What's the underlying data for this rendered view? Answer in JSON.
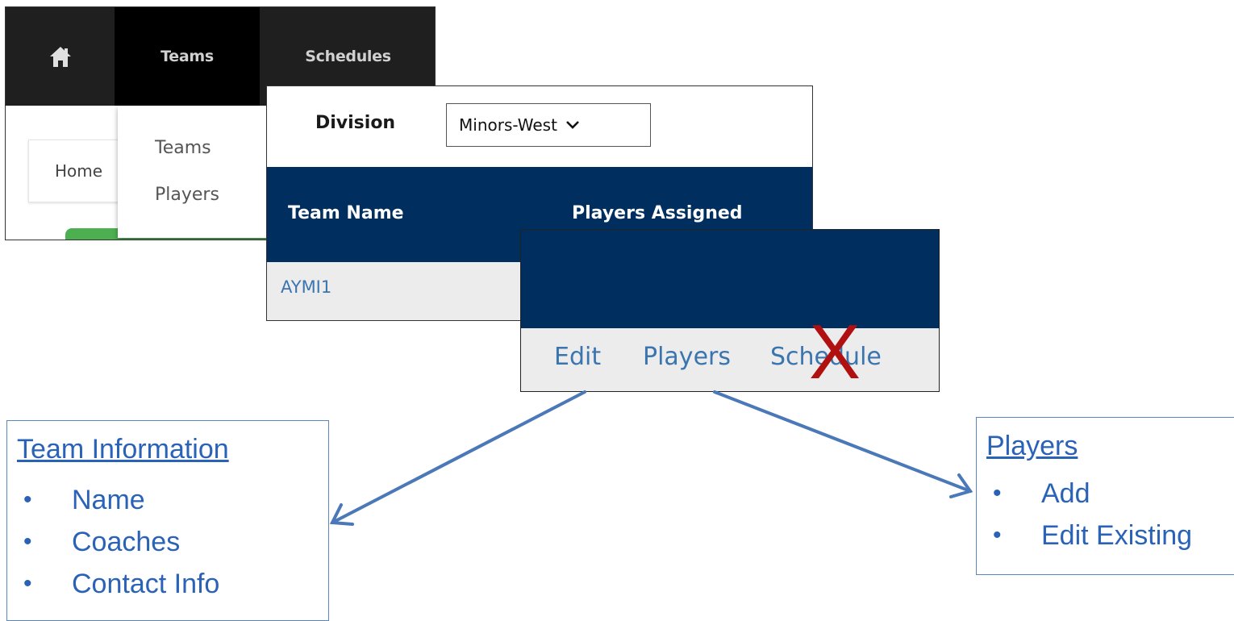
{
  "nav": {
    "home_icon": "home-icon",
    "items": [
      {
        "label": "Teams"
      },
      {
        "label": "Schedules"
      }
    ],
    "dropdown": [
      {
        "label": "Teams"
      },
      {
        "label": "Players"
      }
    ],
    "breadcrumb": "Home"
  },
  "division": {
    "label": "Division",
    "selected": "Minors-West"
  },
  "table": {
    "columns": [
      "Team Name",
      "Players Assigned"
    ],
    "rows": [
      {
        "team_name": "AYMI1"
      }
    ]
  },
  "actions": {
    "links": [
      "Edit",
      "Players",
      "Schedule"
    ],
    "crossed_out_mark": "X",
    "crossed_out_link": "Schedule"
  },
  "callouts": {
    "team_information": {
      "title": "Team Information",
      "items": [
        "Name",
        "Coaches",
        "Contact Info"
      ]
    },
    "players": {
      "title": "Players",
      "items": [
        "Add",
        "Edit Existing"
      ]
    }
  },
  "colors": {
    "nav_bg": "#1f1f1f",
    "table_header": "#002f5f",
    "link": "#3a75b0",
    "callout_text": "#2a62b8",
    "arrow": "#4a78b8",
    "x_mark": "#b01010",
    "green_bar": "#4cb050"
  }
}
